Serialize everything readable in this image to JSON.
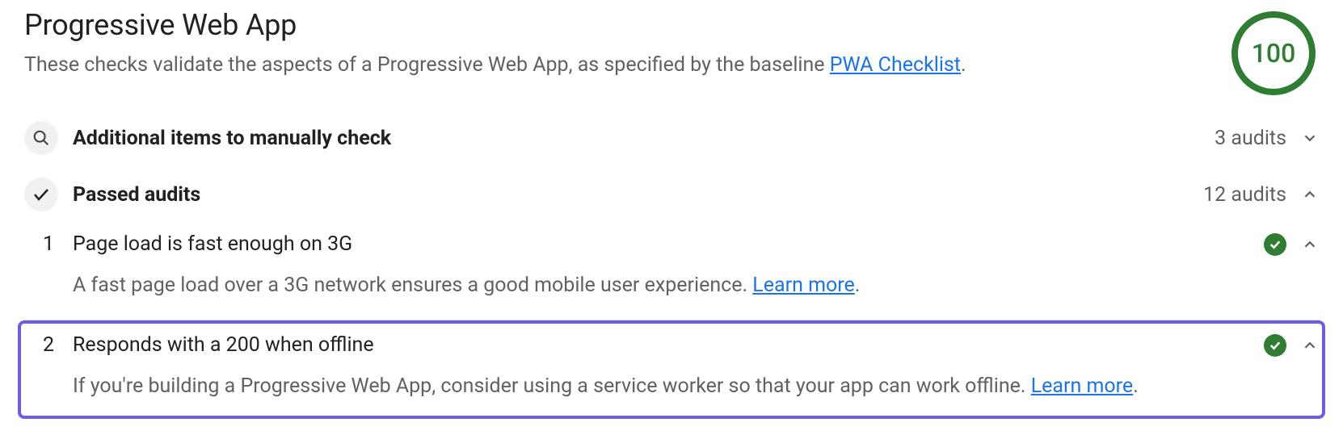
{
  "header": {
    "title": "Progressive Web App",
    "subtitle_prefix": "These checks validate the aspects of a Progressive Web App, as specified by the baseline ",
    "link_text": "PWA Checklist",
    "subtitle_suffix": ".",
    "score": "100"
  },
  "sections": {
    "manual": {
      "title": "Additional items to manually check",
      "count": "3 audits"
    },
    "passed": {
      "title": "Passed audits",
      "count": "12 audits"
    }
  },
  "audits": [
    {
      "num": "1",
      "title": "Page load is fast enough on 3G",
      "description_prefix": "A fast page load over a 3G network ensures a good mobile user experience. ",
      "learn_more": "Learn more",
      "description_suffix": "."
    },
    {
      "num": "2",
      "title": "Responds with a 200 when offline",
      "description_prefix": "If you're building a Progressive Web App, consider using a service worker so that your app can work offline. ",
      "learn_more": "Learn more",
      "description_suffix": "."
    }
  ]
}
